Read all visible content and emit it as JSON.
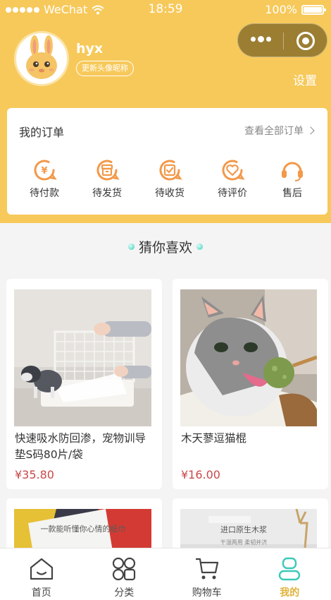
{
  "status_bar": {
    "carrier": "WeChat",
    "time": "18:59",
    "battery": "100%"
  },
  "profile": {
    "username": "hyx",
    "update_label": "更新头像昵称",
    "settings_label": "设置"
  },
  "orders": {
    "title": "我的订单",
    "view_all": "查看全部订单",
    "items": [
      {
        "label": "待付款",
        "icon": "payment-pending-icon"
      },
      {
        "label": "待发货",
        "icon": "shipping-pending-icon"
      },
      {
        "label": "待收货",
        "icon": "receipt-pending-icon"
      },
      {
        "label": "待评价",
        "icon": "review-pending-icon"
      },
      {
        "label": "售后",
        "icon": "after-sales-icon"
      }
    ]
  },
  "recommend": {
    "title": "猜你喜欢",
    "products": [
      {
        "name": "快速吸水防回渗，宠物训导垫S码80片/袋",
        "price": "¥35.80"
      },
      {
        "name": "木天蓼逗猫棍",
        "price": "¥16.00"
      },
      {
        "image_text": "一款能听懂你心情的纸巾"
      },
      {
        "image_text": "进口原生木浆",
        "image_subtext": "干湿两用 柔韧并济"
      }
    ]
  },
  "tabbar": [
    {
      "label": "首页",
      "icon": "home-icon"
    },
    {
      "label": "分类",
      "icon": "category-icon"
    },
    {
      "label": "购物车",
      "icon": "cart-icon"
    },
    {
      "label": "我的",
      "icon": "profile-icon",
      "active": true
    }
  ],
  "colors": {
    "header": "#f7c95a",
    "accent": "#f2994a",
    "price": "#c9484a",
    "active_tab": "#e0b23a",
    "active_icon": "#3cc9b8"
  }
}
